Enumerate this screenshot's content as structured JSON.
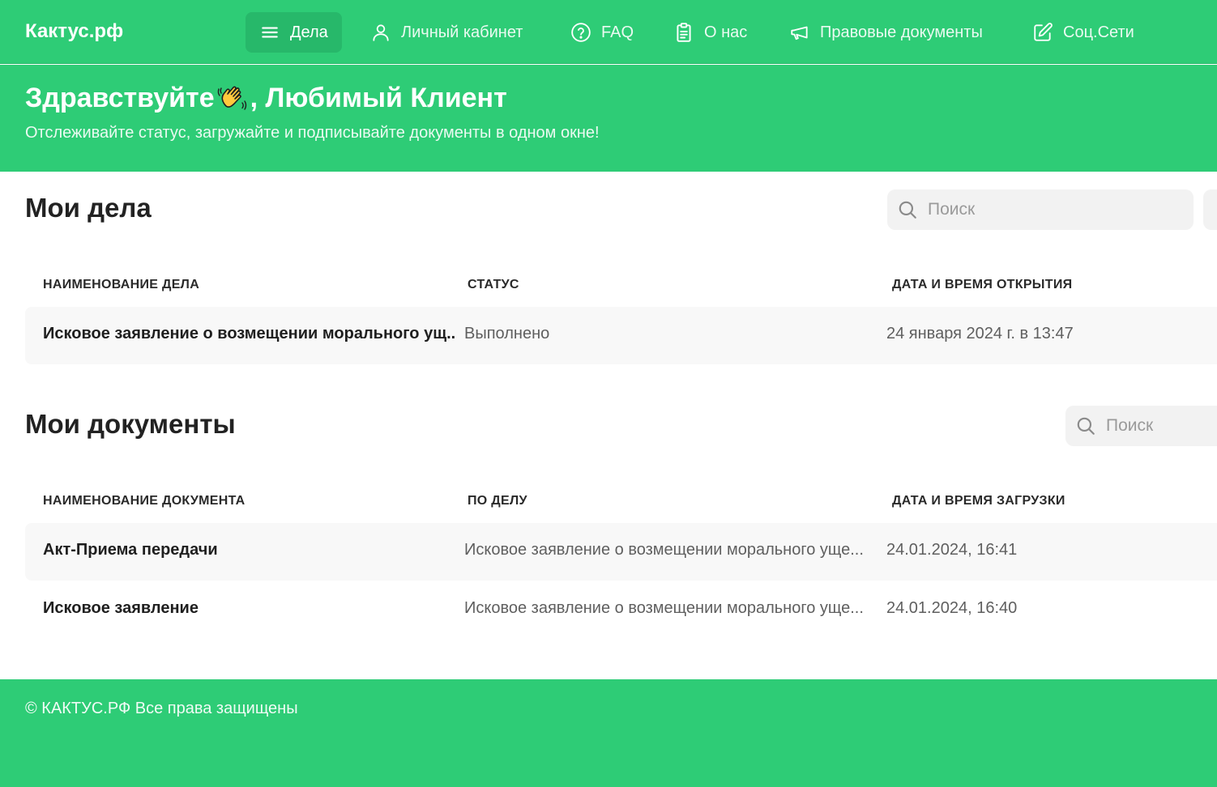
{
  "header": {
    "brand": "Кактус.рф",
    "nav": [
      {
        "label": "Дела",
        "icon": "menu-icon",
        "active": true
      },
      {
        "label": "Личный кабинет",
        "icon": "user-icon"
      },
      {
        "label": "FAQ",
        "icon": "question-icon"
      },
      {
        "label": "О нас",
        "icon": "clipboard-icon"
      },
      {
        "label": "Правовые документы",
        "icon": "megaphone-icon"
      },
      {
        "label": "Соц.Сети",
        "icon": "edit-icon"
      }
    ]
  },
  "hero": {
    "greeting": "Здравствуйте",
    "greeting_suffix": ", Любимый Клиент",
    "emoji_icon": "waving-hand-icon",
    "subtitle": "Отслеживайте статус, загружайте и подписывайте документы в одном окне!"
  },
  "cases": {
    "title": "Мои дела",
    "search_placeholder": "Поиск",
    "columns": [
      "НАИМЕНОВАНИЕ ДЕЛА",
      "СТАТУС",
      "ДАТА И ВРЕМЯ ОТКРЫТИЯ"
    ],
    "rows": [
      {
        "name": "Исковое заявление о возмещении морального ущ...",
        "status": "Выполнено",
        "opened": "24 января 2024 г. в 13:47"
      }
    ]
  },
  "documents": {
    "title": "Мои документы",
    "search_placeholder": "Поиск",
    "columns": [
      "НАИМЕНОВАНИЕ ДОКУМЕНТА",
      "ПО ДЕЛУ",
      "ДАТА И ВРЕМЯ ЗАГРУЗКИ"
    ],
    "rows": [
      {
        "name": "Акт-Приема передачи",
        "case": "Исковое заявление о возмещении морального уще...",
        "uploaded": "24.01.2024, 16:41"
      },
      {
        "name": "Исковое заявление",
        "case": "Исковое заявление о возмещении морального уще...",
        "uploaded": "24.01.2024, 16:40"
      }
    ]
  },
  "footer": {
    "text": "© КАКТУС.РФ Все права защищены"
  },
  "colors": {
    "brand_green": "#2ecc76",
    "active_nav": "#27b86a",
    "row_shade": "#f8f8f8",
    "search_bg": "#f2f2f2"
  }
}
